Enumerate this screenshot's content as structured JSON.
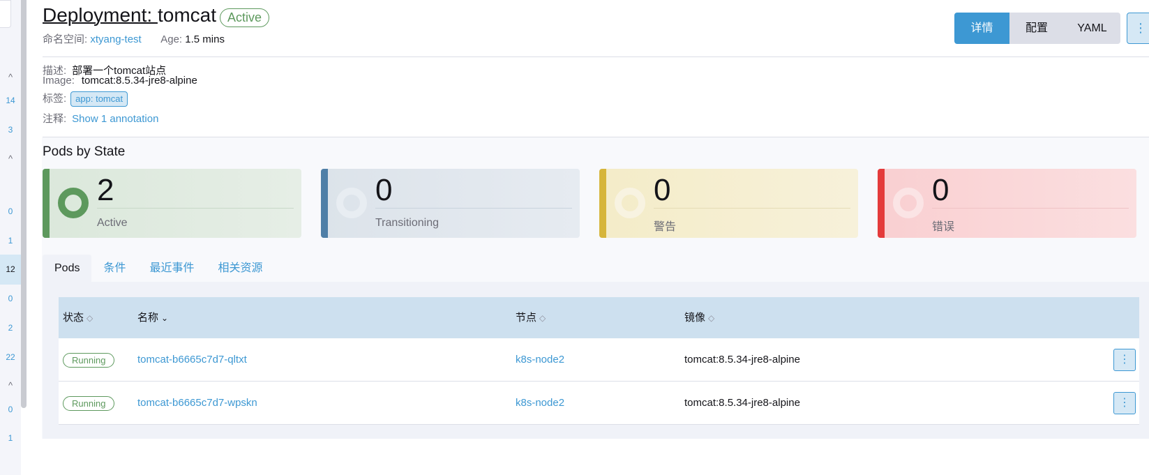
{
  "rail": {
    "items": [
      {
        "text": "^",
        "type": "chev"
      },
      {
        "text": "14"
      },
      {
        "text": "3"
      },
      {
        "text": "^",
        "type": "chev"
      },
      {
        "text": "0"
      },
      {
        "text": "1"
      },
      {
        "text": "12",
        "selected": true
      },
      {
        "text": "0"
      },
      {
        "text": "2"
      },
      {
        "text": "22"
      },
      {
        "text": "^",
        "type": "chev"
      },
      {
        "text": "0"
      },
      {
        "text": "1"
      }
    ]
  },
  "header": {
    "title_prefix": "Deployment: ",
    "title_name": "tomcat",
    "status": "Active",
    "namespace_label": "命名空间:",
    "namespace_value": "xtyang-test",
    "age_label": "Age:",
    "age_value": "1.5 mins",
    "view_buttons": [
      "详情",
      "配置",
      "YAML"
    ],
    "more_icon": "kebab-icon",
    "more_glyph": "⋮"
  },
  "details": {
    "description_label": "描述:",
    "description_value": "部署一个tomcat站点",
    "image_label": "Image:",
    "image_value": "tomcat:8.5.34-jre8-alpine",
    "labels_label": "标签:",
    "label_tag": "app: tomcat",
    "annotations_label": "注释:",
    "annotations_link": "Show 1 annotation"
  },
  "pods_by_state": {
    "title": "Pods by State",
    "cards": [
      {
        "count": "2",
        "label": "Active"
      },
      {
        "count": "0",
        "label": "Transitioning"
      },
      {
        "count": "0",
        "label": "警告"
      },
      {
        "count": "0",
        "label": "错误"
      }
    ]
  },
  "tabs": [
    "Pods",
    "条件",
    "最近事件",
    "相关资源"
  ],
  "table": {
    "columns": [
      "状态",
      "名称",
      "节点",
      "镜像"
    ],
    "sort_glyph": "◇",
    "sort_active_glyph": "⌄",
    "rows": [
      {
        "status": "Running",
        "name": "tomcat-b6665c7d7-qltxt",
        "node": "k8s-node2",
        "image": "tomcat:8.5.34-jre8-alpine"
      },
      {
        "status": "Running",
        "name": "tomcat-b6665c7d7-wpskn",
        "node": "k8s-node2",
        "image": "tomcat:8.5.34-jre8-alpine"
      }
    ]
  },
  "colors": {
    "accent": "#3d98d3",
    "active": "#5d995d",
    "transitioning": "#4f7fa7",
    "warning": "#d6b53a",
    "error": "#e43b3b"
  }
}
